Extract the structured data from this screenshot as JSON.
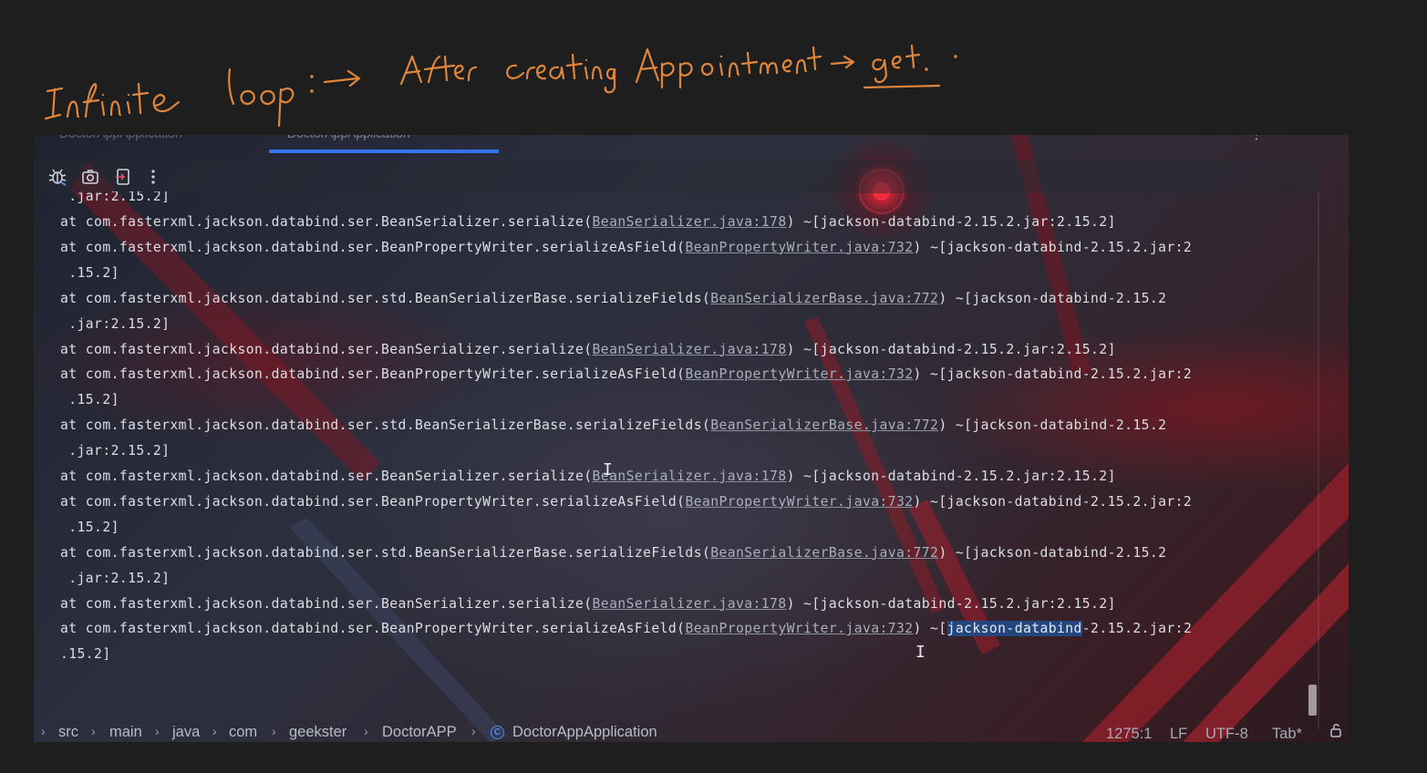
{
  "annotation": {
    "text_left": "Infinite loop :→",
    "text_right": "After creating Appointment → get.",
    "ink_color": "#e0863a"
  },
  "tabs": [
    {
      "label": "DoctorAppApplication",
      "active": false
    },
    {
      "label": "DoctorAppApplication",
      "active": true
    }
  ],
  "tabs_more": "⋮",
  "toolbar": {
    "icons": [
      "debug-bug-icon",
      "camera-icon",
      "exit-icon",
      "more-vertical-icon"
    ]
  },
  "console": {
    "top_partial": " .jar:2.15.2]",
    "lines": [
      {
        "pre": "at com.fasterxml.jackson.databind.ser.BeanSerializer.serialize(",
        "link": "BeanSerializer.java:178",
        "post": ") ~[jackson-databind-2.15.2.jar:2.15.2]"
      },
      {
        "pre": "at com.fasterxml.jackson.databind.ser.BeanPropertyWriter.serializeAsField(",
        "link": "BeanPropertyWriter.java:732",
        "post": ") ~[jackson-databind-2.15.2.jar:2"
      },
      {
        "pre": " .15.2]",
        "link": "",
        "post": ""
      },
      {
        "pre": "at com.fasterxml.jackson.databind.ser.std.BeanSerializerBase.serializeFields(",
        "link": "BeanSerializerBase.java:772",
        "post": ") ~[jackson-databind-2.15.2"
      },
      {
        "pre": " .jar:2.15.2]",
        "link": "",
        "post": ""
      },
      {
        "pre": "at com.fasterxml.jackson.databind.ser.BeanSerializer.serialize(",
        "link": "BeanSerializer.java:178",
        "post": ") ~[jackson-databind-2.15.2.jar:2.15.2]"
      },
      {
        "pre": "at com.fasterxml.jackson.databind.ser.BeanPropertyWriter.serializeAsField(",
        "link": "BeanPropertyWriter.java:732",
        "post": ") ~[jackson-databind-2.15.2.jar:2"
      },
      {
        "pre": " .15.2]",
        "link": "",
        "post": ""
      },
      {
        "pre": "at com.fasterxml.jackson.databind.ser.std.BeanSerializerBase.serializeFields(",
        "link": "BeanSerializerBase.java:772",
        "post": ") ~[jackson-databind-2.15.2"
      },
      {
        "pre": " .jar:2.15.2]",
        "link": "",
        "post": ""
      },
      {
        "pre": "at com.fasterxml.jackson.databind.ser.BeanSerializer.serialize(",
        "link": "BeanSerializer.java:178",
        "post": ") ~[jackson-databind-2.15.2.jar:2.15.2]"
      },
      {
        "pre": "at com.fasterxml.jackson.databind.ser.BeanPropertyWriter.serializeAsField(",
        "link": "BeanPropertyWriter.java:732",
        "post": ") ~[jackson-databind-2.15.2.jar:2"
      },
      {
        "pre": " .15.2]",
        "link": "",
        "post": ""
      },
      {
        "pre": "at com.fasterxml.jackson.databind.ser.std.BeanSerializerBase.serializeFields(",
        "link": "BeanSerializerBase.java:772",
        "post": ") ~[jackson-databind-2.15.2"
      },
      {
        "pre": " .jar:2.15.2]",
        "link": "",
        "post": ""
      },
      {
        "pre": "at com.fasterxml.jackson.databind.ser.BeanSerializer.serialize(",
        "link": "BeanSerializer.java:178",
        "post": ") ~[jackson-databind-2.15.2.jar:2.15.2]"
      },
      {
        "pre": "at com.fasterxml.jackson.databind.ser.BeanPropertyWriter.serializeAsField(",
        "link": "BeanPropertyWriter.java:732",
        "post": ") ~[",
        "selected": "jackson-databind",
        "post2": "-2.15.2.jar:2"
      },
      {
        "pre": ".15.2]",
        "link": "",
        "post": ""
      }
    ]
  },
  "statusbar": {
    "breadcrumb": [
      "src",
      "main",
      "java",
      "com",
      "geekster",
      "DoctorAPP",
      "DoctorAppApplication"
    ],
    "class_icon_letter": "C",
    "position": "1275:1",
    "line_ending": "LF",
    "encoding": "UTF-8",
    "indent": "Tab*"
  }
}
